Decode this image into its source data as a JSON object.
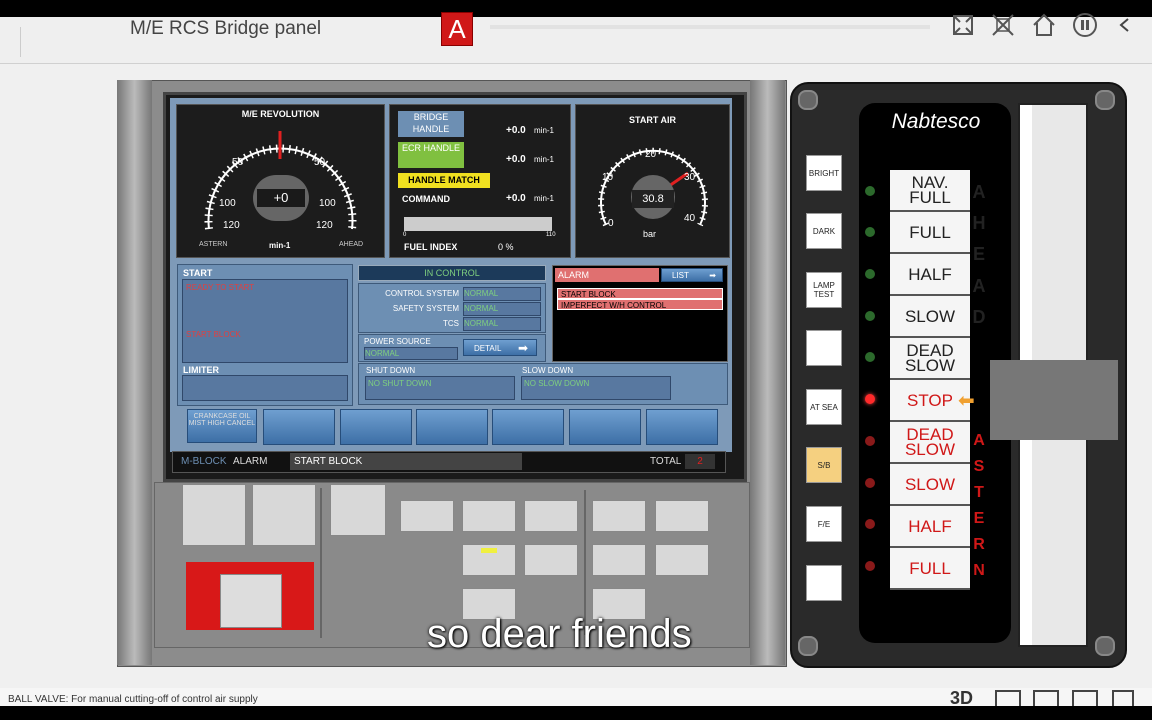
{
  "app": {
    "title": "M/E RCS Bridge panel",
    "logo_letter": "A",
    "icons": [
      "fullscreen-icon",
      "unlink-icon",
      "home-icon",
      "pause-icon",
      "back-icon"
    ]
  },
  "screen": {
    "rev_gauge": {
      "title": "M/E REVOLUTION",
      "value": "+0",
      "unit": "min-1",
      "left_labels": [
        "50",
        "100",
        "120"
      ],
      "right_labels": [
        "50",
        "100",
        "120"
      ],
      "astern": "ASTERN",
      "ahead": "AHEAD"
    },
    "handles": {
      "bridge": "BRIDGE HANDLE",
      "bridge_value": "+0.0",
      "ecr": "ECR HANDLE",
      "ecr_value": "+0.0",
      "handle_match": "HANDLE MATCH",
      "command": "COMMAND",
      "command_value": "+0.0",
      "unit": "min-1",
      "fuel_label": "FUEL INDEX",
      "fuel_value": "0 %",
      "fuel_min": "0",
      "fuel_max": "110"
    },
    "start_air": {
      "title": "START AIR",
      "labels": [
        "0",
        "10",
        "20",
        "30",
        "40"
      ],
      "value": "30.8",
      "unit": "bar"
    },
    "start_panel": {
      "title": "START",
      "line1": "READY TO START",
      "line2": "START BLOCK",
      "limiter": "LIMITER"
    },
    "control": {
      "title": "IN CONTROL",
      "rows": [
        {
          "label": "CONTROL SYSTEM",
          "value": "NORMAL"
        },
        {
          "label": "SAFETY SYSTEM",
          "value": "NORMAL"
        },
        {
          "label": "TCS",
          "value": "NORMAL"
        }
      ],
      "power_label": "POWER SOURCE",
      "power_value": "NORMAL",
      "detail": "DETAIL"
    },
    "alarm": {
      "title": "ALARM",
      "list_btn": "LIST",
      "items": [
        "START BLOCK",
        "IMPERFECT W/H CONTROL"
      ]
    },
    "shutdown": {
      "title": "SHUT DOWN",
      "value": "NO SHUT DOWN"
    },
    "slowdown": {
      "title": "SLOW DOWN",
      "value": "NO SLOW DOWN"
    },
    "softkey1": "CRANKCASE OIL MIST HIGH CANCEL",
    "statusbar": {
      "mode": "M-BLOCK",
      "alarm_label": "ALARM",
      "alarm_text": "START BLOCK",
      "total_label": "TOTAL",
      "total_value": "2"
    }
  },
  "telegraph": {
    "brand": "Nabtesco",
    "side_buttons": [
      "BRIGHT",
      "DARK",
      "LAMP TEST",
      "",
      "AT SEA",
      "S/B",
      "F/E",
      ""
    ],
    "orders_ahead": [
      "NAV. FULL",
      "FULL",
      "HALF",
      "SLOW",
      "DEAD SLOW"
    ],
    "stop": "STOP",
    "orders_astern": [
      "DEAD SLOW",
      "SLOW",
      "HALF",
      "FULL"
    ],
    "ahead_letters": [
      "A",
      "H",
      "E",
      "A",
      "D"
    ],
    "astern_letters": [
      "A",
      "S",
      "T",
      "E",
      "R",
      "N"
    ]
  },
  "subtitle": "so dear friends",
  "status_text": "BALL VALVE: For manual cutting-off of control air supply",
  "bottom_icons": [
    "3D"
  ]
}
